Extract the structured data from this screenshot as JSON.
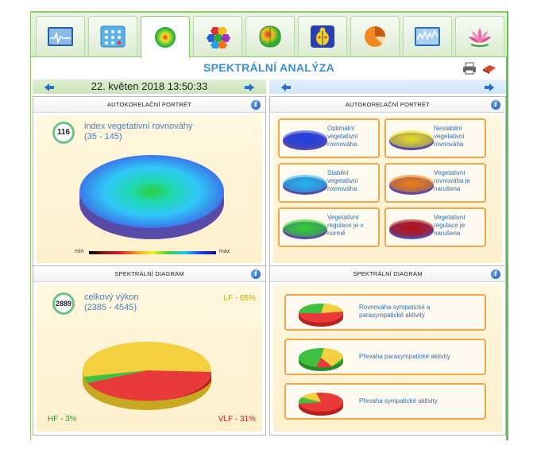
{
  "title": "SPEKTRÁLNÍ ANALÝZA",
  "tabs": [
    {
      "icon": "ecg-chart-icon"
    },
    {
      "icon": "dots-grid-icon"
    },
    {
      "icon": "spectral-disc-icon",
      "active": true
    },
    {
      "icon": "hexagon-cluster-icon"
    },
    {
      "icon": "brain-map-icon"
    },
    {
      "icon": "beetle-icon"
    },
    {
      "icon": "pie-chart-icon"
    },
    {
      "icon": "wave-chart-icon"
    },
    {
      "icon": "lotus-icon"
    }
  ],
  "date": "22. květen 2018 13:50:33",
  "left_top_panel": {
    "title": "AUTOKORELAČNÍ PORTRÉT",
    "badge": "116",
    "metric_name": "index vegetativní rovnováhy",
    "metric_range": "(35 - 145)",
    "scale_min": "min",
    "scale_max": "max"
  },
  "right_top_panel": {
    "title": "AUTOKORELAČNÍ PORTRÉT",
    "legend": [
      {
        "l1": "Optimální",
        "l2": "vegetativní",
        "l3": "rovnováha",
        "color": "#1f3fe0"
      },
      {
        "l1": "Nestabilní",
        "l2": "vegetativní",
        "l3": "rovnováha",
        "color": "#e8e020"
      },
      {
        "l1": "Stabilní",
        "l2": "vegetativní",
        "l3": "rovnováha",
        "color": "#1fb8f0"
      },
      {
        "l1": "Vegetativní",
        "l2": "rovnováha je",
        "l3": "narušena",
        "color": "#f08010"
      },
      {
        "l1": "Vegetativní",
        "l2": "regulace je v",
        "l3": "normě",
        "color": "#30d030"
      },
      {
        "l1": "Vegetativní",
        "l2": "regulace je",
        "l3": "narušena",
        "color": "#b81010"
      }
    ]
  },
  "left_bottom_panel": {
    "title": "SPEKTRÁLNÍ DIAGRAM",
    "badge": "2889",
    "metric_name": "celkový výkon",
    "metric_range": "(2385 - 4545)",
    "lf": "LF - 65%",
    "hf": "HF - 3%",
    "vlf": "VLF - 31%"
  },
  "right_bottom_panel": {
    "title": "SPEKTRÁLNÍ DIAGRAM",
    "items": [
      {
        "l1": "Rovnováha sympatické a",
        "l2": "parasympatické aktivity"
      },
      {
        "l1": "Převaha parasympatické aktivity",
        "l2": ""
      },
      {
        "l1": "Převaha sympatické aktivity",
        "l2": ""
      }
    ]
  },
  "colors": {
    "accent": "#3a8fd6",
    "green": "#5fc24a",
    "orange": "#f2a64a"
  }
}
